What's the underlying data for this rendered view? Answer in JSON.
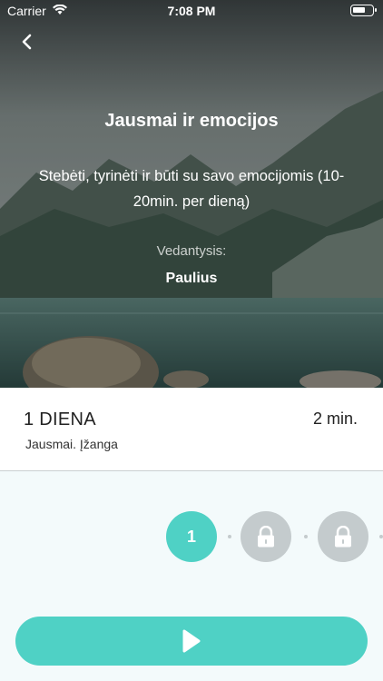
{
  "status_bar": {
    "carrier": "Carrier",
    "time": "7:08 PM"
  },
  "course": {
    "title": "Jausmai ir emocijos",
    "description": "Stebėti, tyrinėti ir būti su savo emocijomis (10-20min. per dieną)",
    "guide_label": "Vedantysis:",
    "guide_name": "Paulius"
  },
  "lesson": {
    "day": "1 DIENA",
    "name": "Jausmai. Įžanga",
    "duration": "2 min."
  },
  "steps": [
    {
      "label": "1",
      "state": "active"
    },
    {
      "label": "",
      "state": "locked"
    },
    {
      "label": "",
      "state": "locked"
    }
  ],
  "colors": {
    "accent": "#4fd1c5",
    "locked": "#c4cbcd"
  },
  "icons": {
    "back": "chevron-left-icon",
    "lock": "lock-icon",
    "play": "play-icon"
  }
}
